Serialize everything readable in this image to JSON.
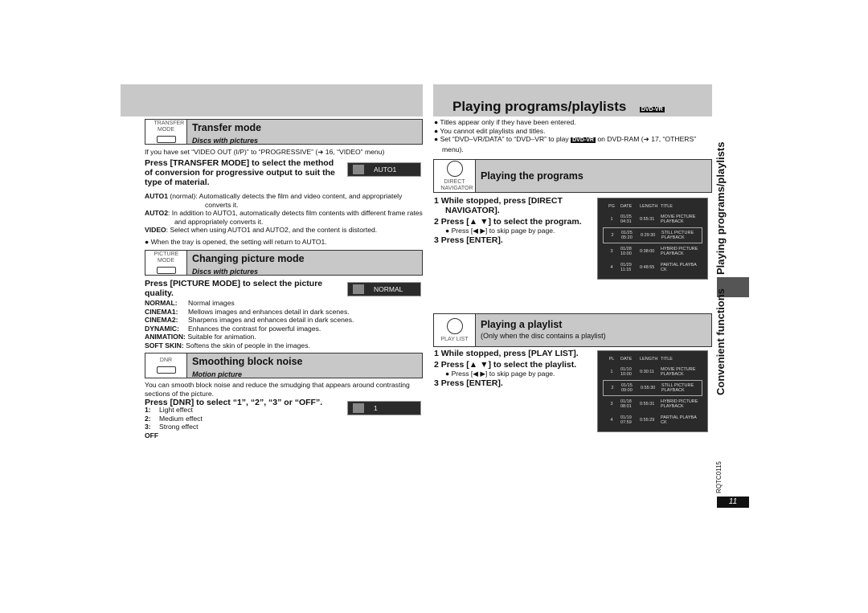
{
  "left": {
    "transfer": {
      "icon_label": "TRANSFER MODE",
      "title": "Transfer mode",
      "sub": "Discs with pictures",
      "intro": "If you have set “VIDEO OUT (I/P)” to “PROGRESSIVE” (➜ 16, “VIDEO” menu)",
      "instruction": "Press [TRANSFER MODE] to select the method of conversion for progressive output to suit the type of material.",
      "osd": "AUTO1",
      "items": [
        {
          "k": "AUTO1",
          "v": " (normal):  Automatically detects the film and video content, and appropriately converts it."
        },
        {
          "k": "AUTO2",
          "v": ":  In addition to AUTO1, automatically detects film contents with different frame rates and appropriately converts it."
        },
        {
          "k": "VIDEO",
          "v": ":  Select when using AUTO1 and AUTO2, and the content is distorted."
        }
      ],
      "note": "● When the tray is opened, the setting will return to AUTO1."
    },
    "picture": {
      "icon_label": "PICTURE MODE",
      "title": "Changing picture mode",
      "sub": "Discs with pictures",
      "instruction": "Press [PICTURE MODE] to select the picture quality.",
      "osd": "NORMAL",
      "items": [
        {
          "k": "NORMAL:",
          "v": "Normal images"
        },
        {
          "k": "CINEMA1:",
          "v": "Mellows images and enhances detail in dark scenes."
        },
        {
          "k": "CINEMA2:",
          "v": "Sharpens images and enhances detail in dark scenes."
        },
        {
          "k": "DYNAMIC:",
          "v": "Enhances the contrast for powerful images."
        },
        {
          "k": "ANIMATION:",
          "v": "Suitable for animation."
        },
        {
          "k": "SOFT SKIN:",
          "v": "Softens the skin of people in the images."
        }
      ]
    },
    "dnr": {
      "icon_label": "DNR",
      "title": "Smoothing block noise",
      "sub": "Motion picture",
      "intro": "You can smooth block noise and reduce the smudging that appears around contrasting sections of the picture.",
      "instruction": "Press [DNR] to select “1”, “2”, “3” or “OFF”.",
      "osd": "1",
      "items": [
        {
          "k": "1:",
          "v": "Light effect"
        },
        {
          "k": "2:",
          "v": "Medium effect"
        },
        {
          "k": "3:",
          "v": "Strong effect"
        },
        {
          "k": "OFF",
          "v": ""
        }
      ]
    }
  },
  "right": {
    "title": "Playing programs/playlists",
    "badge": "DVD-VR",
    "notes": [
      "● Titles appear only if they have been entered.",
      "● You cannot edit playlists and titles."
    ],
    "note3a": "●  Set “DVD–VR/DATA” to “DVD–VR” to play ",
    "note3b": " on DVD-RAM (➜ 17, “OTHERS” menu).",
    "programs": {
      "icon_label": "DIRECT NAVIGATOR",
      "title": "Playing the programs",
      "steps": [
        "1  While stopped, press [DIRECT NAVIGATOR].",
        "2  Press [▲ ▼] to select the program."
      ],
      "bullet": "● Press [◀ ▶] to skip page by page.",
      "step3": "3  Press [ENTER].",
      "screen": {
        "headers": [
          "PG",
          "DATE",
          "LENGTH",
          "TITLE"
        ],
        "rows": [
          [
            "1",
            "01/25 04:31",
            "0:55:31",
            "MOVIE PICTURE PLAYBACK"
          ],
          [
            "2",
            "01/25 05:20",
            "0:29:30",
            "STILL PICTURE PLAYBACK"
          ],
          [
            "3",
            "01/28 10:00",
            "0:38:00",
            "HYBRID PICTURE PLAYBACK"
          ],
          [
            "4",
            "01/29 11:15",
            "0:48:55",
            "PARTIAL PLAYBA CK"
          ]
        ]
      }
    },
    "playlist": {
      "icon_label": "PLAY LIST",
      "title": "Playing a playlist",
      "sub": "(Only when the disc contains a playlist)",
      "steps": [
        "1  While stopped, press [PLAY LIST].",
        "2  Press [▲ ▼] to select the playlist."
      ],
      "bullet": "● Press [◀ ▶] to skip page by page.",
      "step3": "3  Press [ENTER].",
      "screen": {
        "headers": [
          "PL",
          "DATE",
          "LENGTH",
          "TITLE"
        ],
        "rows": [
          [
            "1",
            "01/10 10:00",
            "0:30:11",
            "MOVIE PICTURE PLAYBACK"
          ],
          [
            "2",
            "01/15 09:00",
            "0:55:30",
            "STILL PICTURE PLAYBACK"
          ],
          [
            "3",
            "01/18 08:01",
            "0:55:31",
            "HYBRID PICTURE PLAYBACK"
          ],
          [
            "4",
            "01/19 07:59",
            "0:55:29",
            "PARTIAL PLAYBA CK"
          ]
        ]
      }
    }
  },
  "side": {
    "section1": "Playing programs/playlists",
    "section2": "Convenient functions",
    "code": "RQTC0115",
    "page": "11"
  }
}
